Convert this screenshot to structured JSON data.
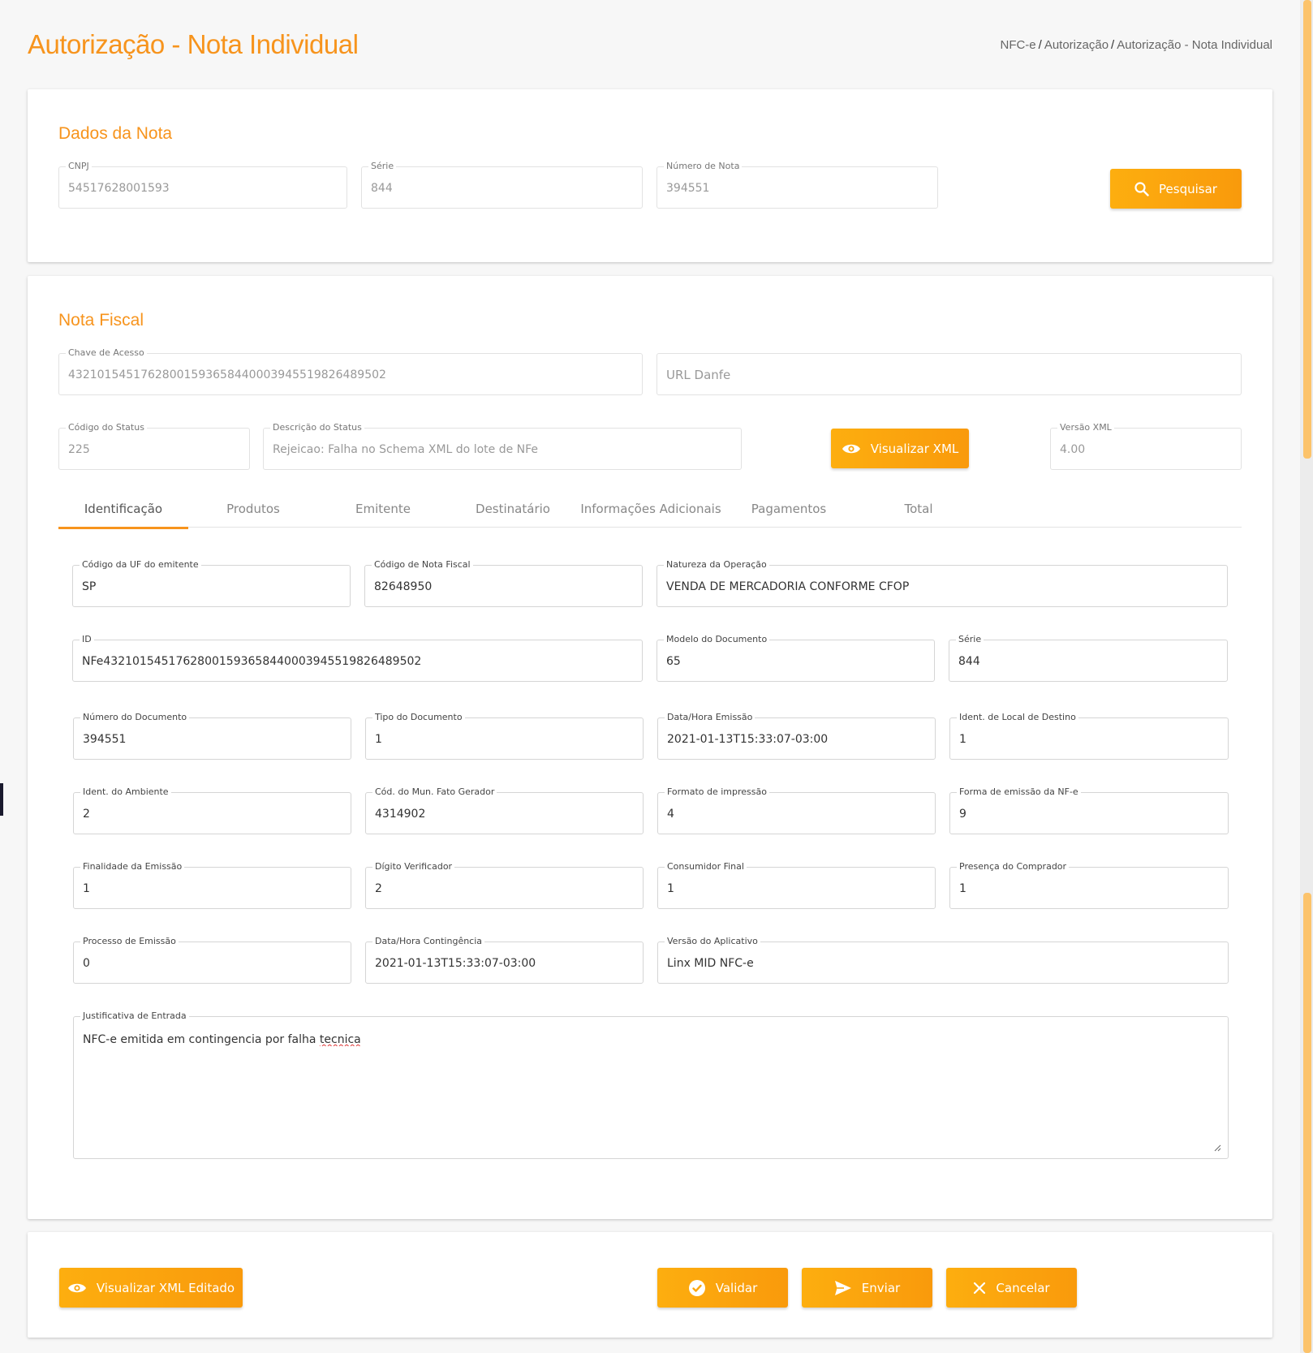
{
  "header": {
    "title": "Autorização - Nota Individual",
    "breadcrumb": [
      "NFC-e",
      "Autorização",
      "Autorização - Nota Individual"
    ]
  },
  "dados_nota": {
    "title": "Dados da Nota",
    "cnpj": {
      "label": "CNPJ",
      "value": "54517628001593"
    },
    "serie": {
      "label": "Série",
      "value": "844"
    },
    "numero": {
      "label": "Número de Nota",
      "value": "394551"
    },
    "search_button": "Pesquisar"
  },
  "nota_fiscal": {
    "title": "Nota Fiscal",
    "chave": {
      "label": "Chave de Acesso",
      "value": "43210154517628001593658440003945519826489502"
    },
    "url_danfe": {
      "placeholder": "URL Danfe"
    },
    "codigo_status": {
      "label": "Código do Status",
      "value": "225"
    },
    "descricao_status": {
      "label": "Descrição do Status",
      "value": "Rejeicao: Falha no Schema XML do lote de NFe"
    },
    "view_xml_button": "Visualizar XML",
    "versao_xml": {
      "label": "Versão XML",
      "value": "4.00"
    },
    "tabs": [
      "Identificação",
      "Produtos",
      "Emitente",
      "Destinatário",
      "Informações Adicionais",
      "Pagamentos",
      "Total"
    ],
    "fields": {
      "uf": {
        "label": "Código da UF do emitente",
        "value": "SP"
      },
      "codigo_nf": {
        "label": "Código de Nota Fiscal",
        "value": "82648950"
      },
      "natureza": {
        "label": "Natureza da Operação",
        "value": "VENDA DE MERCADORIA CONFORME CFOP"
      },
      "id": {
        "label": "ID",
        "value": "NFe43210154517628001593658440003945519826489502"
      },
      "modelo": {
        "label": "Modelo do Documento",
        "value": "65"
      },
      "serie": {
        "label": "Série",
        "value": "844"
      },
      "numero_doc": {
        "label": "Número do Documento",
        "value": "394551"
      },
      "tipo_doc": {
        "label": "Tipo do Documento",
        "value": "1"
      },
      "data_emissao": {
        "label": "Data/Hora Emissão",
        "value": "2021-01-13T15:33:07-03:00"
      },
      "local_destino": {
        "label": "Ident. de Local de Destino",
        "value": "1"
      },
      "ambiente": {
        "label": "Ident. do Ambiente",
        "value": "2"
      },
      "mun_fato": {
        "label": "Cód. do Mun. Fato Gerador",
        "value": "4314902"
      },
      "formato_impressao": {
        "label": "Formato de impressão",
        "value": "4"
      },
      "forma_emissao": {
        "label": "Forma de emissão da NF-e",
        "value": "9"
      },
      "finalidade": {
        "label": "Finalidade da Emissão",
        "value": "1"
      },
      "digito": {
        "label": "Dígito Verificador",
        "value": "2"
      },
      "consumidor": {
        "label": "Consumidor Final",
        "value": "1"
      },
      "presenca": {
        "label": "Presença do Comprador",
        "value": "1"
      },
      "processo": {
        "label": "Processo de Emissão",
        "value": "0"
      },
      "data_contingencia": {
        "label": "Data/Hora Contingência",
        "value": "2021-01-13T15:33:07-03:00"
      },
      "versao_app": {
        "label": "Versão do Aplicativo",
        "value": "Linx MID NFC-e"
      },
      "justificativa": {
        "label": "Justificativa de Entrada",
        "value_prefix": "NFC-e emitida em contingencia por falha ",
        "value_underlined": "tecnica"
      }
    }
  },
  "footer": {
    "view_edited_xml_button": "Visualizar XML Editado",
    "validate_button": "Validar",
    "send_button": "Enviar",
    "cancel_button": "Cancelar"
  },
  "colors": {
    "accent": "#f7941d",
    "button": "#fca70e"
  },
  "icons": [
    "search-icon",
    "eye-icon",
    "check-circle-icon",
    "send-icon",
    "close-icon",
    "resize-handle-icon"
  ]
}
